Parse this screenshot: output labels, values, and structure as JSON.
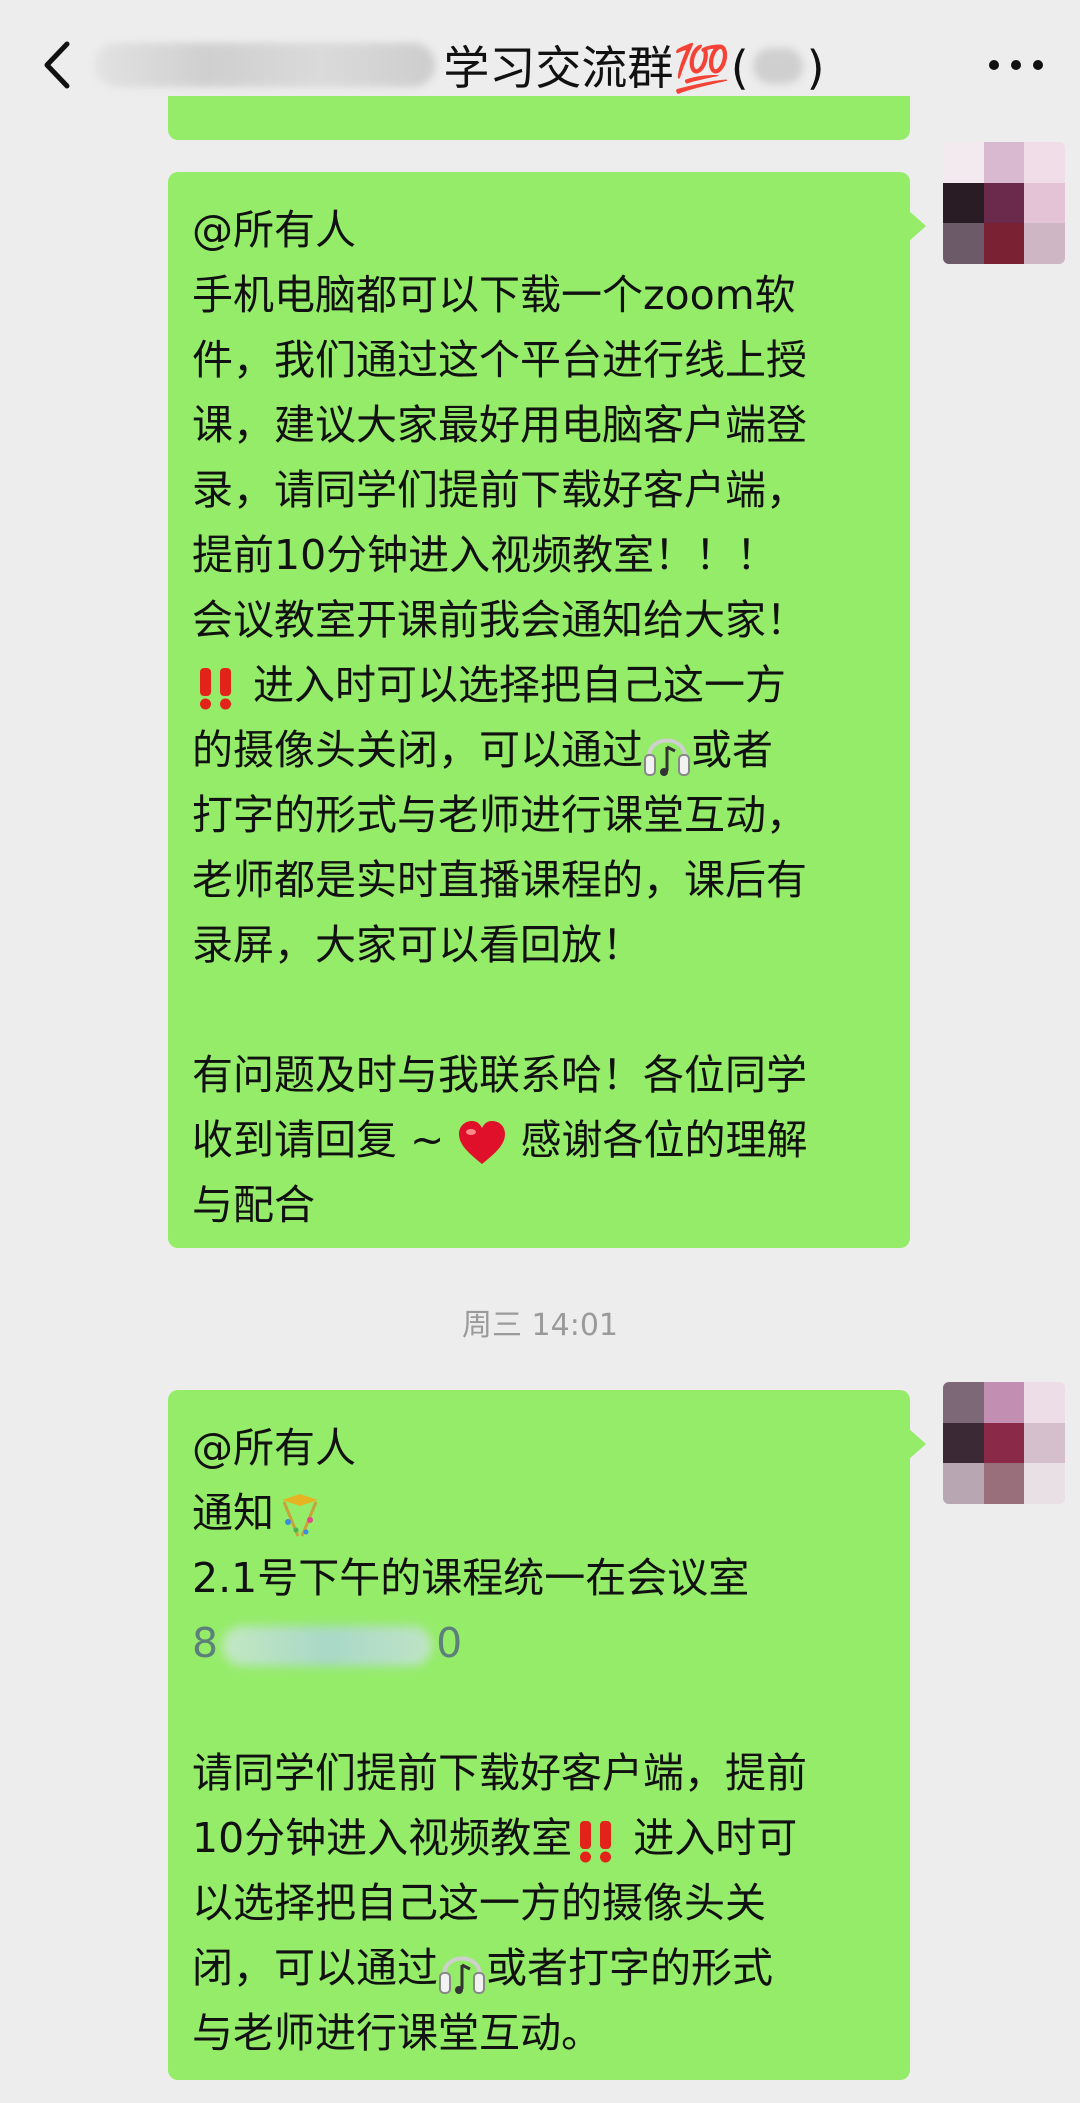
{
  "header": {
    "title_visible": "学习交流群💯",
    "title_paren_open": "(",
    "title_paren_close": ")",
    "more_label": "···"
  },
  "messages": [
    {
      "id": "msg1",
      "lines": [
        "@所有人",
        "手机电脑都可以下载一个zoom软",
        "件，我们通过这个平台进行线上授",
        "课，建议大家最好用电脑客户端登",
        "录，请同学们提前下载好客户端，",
        "提前10分钟进入视频教室！！！",
        "会议教室开课前我会通知给大家！",
        "进入时可以选择把自己这一方",
        "的摄像头关闭，可以通过",
        "或者",
        "打字的形式与老师进行课堂互动，",
        "老师都是实时直播课程的，课后有",
        "录屏，大家可以看回放！",
        "有问题及时与我联系哈！各位同学",
        "收到请回复 ~",
        "感谢各位的理解",
        "与配合"
      ]
    },
    {
      "id": "msg2",
      "lines": [
        "@所有人",
        "通知",
        "2.1号下午的课程统一在会议室",
        "8",
        "0",
        "请同学们提前下载好客户端，提前",
        "10分钟进入视频教室",
        "进入时可",
        "以选择把自己这一方的摄像头关",
        "闭，可以通过",
        "或者打字的形式",
        "与老师进行课堂互动。"
      ]
    }
  ],
  "timestamp": "周三 14:01",
  "icons": {
    "back": "chevron-left-icon",
    "more": "more-dots-icon",
    "double_exclamation": "double-exclamation-icon",
    "earphone": "earphone-icon",
    "heart": "red-heart-icon",
    "party": "party-popper-icon"
  },
  "colors": {
    "bubble": "#95ec69",
    "background": "#ededed",
    "exclamation": "#e2231a",
    "heart": "#e0102a",
    "timestamp": "#9a9a9a"
  }
}
